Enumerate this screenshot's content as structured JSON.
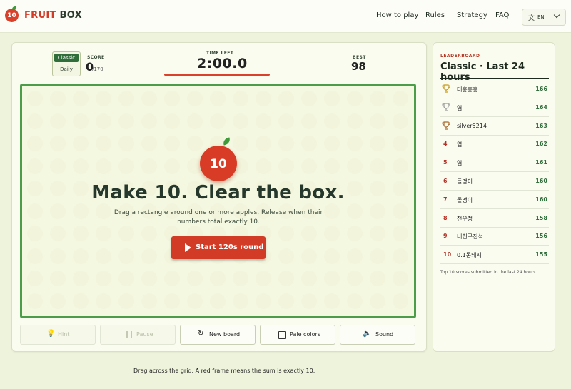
{
  "brand": {
    "logo_text": "10",
    "name_part1": "FRUIT",
    "name_part2": "BOX"
  },
  "nav": {
    "how_to_play": "How to play",
    "rules": "Rules",
    "strategy": "Strategy",
    "faq": "FAQ"
  },
  "lang": {
    "code": "EN",
    "icon": "translate-icon"
  },
  "status": {
    "mode_classic": "Classic",
    "mode_daily": "Daily",
    "score_label": "SCORE",
    "score_value": "0",
    "score_max": "/170",
    "time_label": "TIME LEFT",
    "time_value": "2:00.0",
    "best_label": "BEST",
    "best_value": "98",
    "time_fraction": 1.0
  },
  "intro": {
    "apple_number": "10",
    "headline": "Make 10. Clear the box.",
    "subtitle": "Drag a rectangle around one or more apples. Release when their numbers total exactly 10.",
    "start_label": "Start 120s round"
  },
  "controls": {
    "hint": "Hint",
    "pause": "Pause",
    "new_board": "New board",
    "pale_colors": "Pale colors",
    "sound": "Sound"
  },
  "footer_note": "Drag across the grid. A red frame means the sum is exactly 10.",
  "leaderboard": {
    "kicker": "LEADERBOARD",
    "title": "Classic · Last 24 hours",
    "entries": [
      {
        "rank": "1",
        "name": "태홍홍홍",
        "score": "166",
        "trophy": "gold"
      },
      {
        "rank": "2",
        "name": "염",
        "score": "164",
        "trophy": "silver"
      },
      {
        "rank": "3",
        "name": "silver5214",
        "score": "163",
        "trophy": "bronze"
      },
      {
        "rank": "4",
        "name": "염",
        "score": "162"
      },
      {
        "rank": "5",
        "name": "염",
        "score": "161"
      },
      {
        "rank": "6",
        "name": "돌맹이",
        "score": "160"
      },
      {
        "rank": "7",
        "name": "돌맹이",
        "score": "160"
      },
      {
        "rank": "8",
        "name": "전우정",
        "score": "158"
      },
      {
        "rank": "9",
        "name": "내친구진석",
        "score": "156"
      },
      {
        "rank": "10",
        "name": "0.1돈돼지",
        "score": "155"
      }
    ],
    "footnote": "Top 10 scores submitted in the last 24 hours."
  },
  "colors": {
    "accent_red": "#d23b26",
    "accent_green": "#4c9d4a",
    "gold": "#c79a1e",
    "silver": "#9a9a9a",
    "bronze": "#a8672a"
  }
}
